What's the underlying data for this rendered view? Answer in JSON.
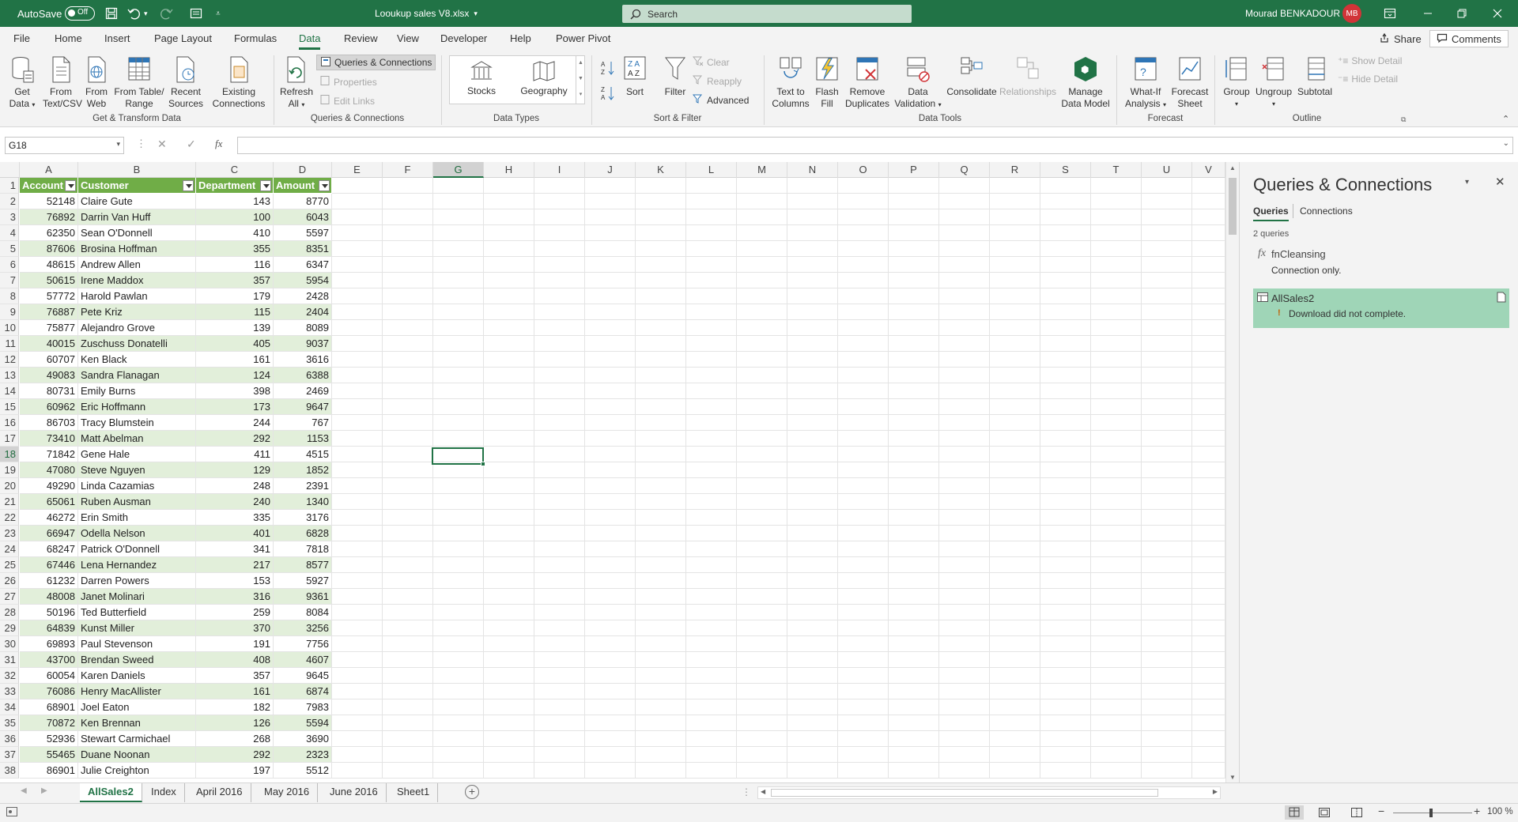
{
  "titlebar": {
    "autosave_label": "AutoSave",
    "autosave_state": "Off",
    "filename": "Looukup sales V8.xlsx",
    "search_placeholder": "Search",
    "user_name": "Mourad BENKADOUR",
    "user_initials": "MB"
  },
  "menu": {
    "tabs": [
      "File",
      "Home",
      "Insert",
      "Page Layout",
      "Formulas",
      "Data",
      "Review",
      "View",
      "Developer",
      "Help",
      "Power Pivot"
    ],
    "active": "Data",
    "share": "Share",
    "comments": "Comments"
  },
  "ribbon": {
    "get_data": [
      "Get",
      "Data"
    ],
    "from_text": [
      "From",
      "Text/CSV"
    ],
    "from_web": [
      "From",
      "Web"
    ],
    "from_table": [
      "From Table/",
      "Range"
    ],
    "recent_sources": [
      "Recent",
      "Sources"
    ],
    "existing_connections": [
      "Existing",
      "Connections"
    ],
    "group_get_transform": "Get & Transform Data",
    "refresh_all": [
      "Refresh",
      "All"
    ],
    "queries_connections": "Queries & Connections",
    "properties": "Properties",
    "edit_links": "Edit Links",
    "group_queries": "Queries & Connections",
    "stocks": "Stocks",
    "geography": "Geography",
    "group_data_types": "Data Types",
    "sort": "Sort",
    "filter": "Filter",
    "clear": "Clear",
    "reapply": "Reapply",
    "advanced": "Advanced",
    "group_sort_filter": "Sort & Filter",
    "text_to_columns": [
      "Text to",
      "Columns"
    ],
    "flash_fill": [
      "Flash",
      "Fill"
    ],
    "remove_duplicates": [
      "Remove",
      "Duplicates"
    ],
    "data_validation": [
      "Data",
      "Validation"
    ],
    "consolidate": "Consolidate",
    "relationships": "Relationships",
    "manage_data_model": [
      "Manage",
      "Data Model"
    ],
    "group_data_tools": "Data Tools",
    "what_if": [
      "What-If",
      "Analysis"
    ],
    "forecast_sheet": [
      "Forecast",
      "Sheet"
    ],
    "group_forecast": "Forecast",
    "group_btn": "Group",
    "ungroup": "Ungroup",
    "subtotal": "Subtotal",
    "show_detail": "Show Detail",
    "hide_detail": "Hide Detail",
    "group_outline": "Outline"
  },
  "formula_bar": {
    "name_box": "G18",
    "formula": ""
  },
  "columns": [
    "A",
    "B",
    "C",
    "D",
    "E",
    "F",
    "G",
    "H",
    "I",
    "J",
    "K",
    "L",
    "M",
    "N",
    "O",
    "P",
    "Q",
    "R",
    "S",
    "T",
    "U",
    "V"
  ],
  "selected_cell": "G18",
  "table": {
    "headers": [
      "Account",
      "Customer",
      "Department",
      "Amount"
    ],
    "rows": [
      [
        "52148",
        "Claire Gute",
        "143",
        "8770"
      ],
      [
        "76892",
        "Darrin Van Huff",
        "100",
        "6043"
      ],
      [
        "62350",
        "Sean O'Donnell",
        "410",
        "5597"
      ],
      [
        "87606",
        "Brosina Hoffman",
        "355",
        "8351"
      ],
      [
        "48615",
        "Andrew Allen",
        "116",
        "6347"
      ],
      [
        "50615",
        "Irene Maddox",
        "357",
        "5954"
      ],
      [
        "57772",
        "Harold Pawlan",
        "179",
        "2428"
      ],
      [
        "76887",
        "Pete Kriz",
        "115",
        "2404"
      ],
      [
        "75877",
        "Alejandro Grove",
        "139",
        "8089"
      ],
      [
        "40015",
        "Zuschuss Donatelli",
        "405",
        "9037"
      ],
      [
        "60707",
        "Ken Black",
        "161",
        "3616"
      ],
      [
        "49083",
        "Sandra Flanagan",
        "124",
        "6388"
      ],
      [
        "80731",
        "Emily Burns",
        "398",
        "2469"
      ],
      [
        "60962",
        "Eric Hoffmann",
        "173",
        "9647"
      ],
      [
        "86703",
        "Tracy Blumstein",
        "244",
        "767"
      ],
      [
        "73410",
        "Matt Abelman",
        "292",
        "1153"
      ],
      [
        "71842",
        "Gene Hale",
        "411",
        "4515"
      ],
      [
        "47080",
        "Steve Nguyen",
        "129",
        "1852"
      ],
      [
        "49290",
        "Linda Cazamias",
        "248",
        "2391"
      ],
      [
        "65061",
        "Ruben Ausman",
        "240",
        "1340"
      ],
      [
        "46272",
        "Erin Smith",
        "335",
        "3176"
      ],
      [
        "66947",
        "Odella Nelson",
        "401",
        "6828"
      ],
      [
        "68247",
        "Patrick O'Donnell",
        "341",
        "7818"
      ],
      [
        "67446",
        "Lena Hernandez",
        "217",
        "8577"
      ],
      [
        "61232",
        "Darren Powers",
        "153",
        "5927"
      ],
      [
        "48008",
        "Janet Molinari",
        "316",
        "9361"
      ],
      [
        "50196",
        "Ted Butterfield",
        "259",
        "8084"
      ],
      [
        "64839",
        "Kunst Miller",
        "370",
        "3256"
      ],
      [
        "69893",
        "Paul Stevenson",
        "191",
        "7756"
      ],
      [
        "43700",
        "Brendan Sweed",
        "408",
        "4607"
      ],
      [
        "60054",
        "Karen Daniels",
        "357",
        "9645"
      ],
      [
        "76086",
        "Henry MacAllister",
        "161",
        "6874"
      ],
      [
        "68901",
        "Joel Eaton",
        "182",
        "7983"
      ],
      [
        "70872",
        "Ken Brennan",
        "126",
        "5594"
      ],
      [
        "52936",
        "Stewart Carmichael",
        "268",
        "3690"
      ],
      [
        "55465",
        "Duane Noonan",
        "292",
        "2323"
      ],
      [
        "86901",
        "Julie Creighton",
        "197",
        "5512"
      ]
    ]
  },
  "queries_panel": {
    "title": "Queries & Connections",
    "tabs": [
      "Queries",
      "Connections"
    ],
    "count": "2 queries",
    "items": [
      {
        "name": "fnCleansing",
        "status": "Connection only."
      },
      {
        "name": "AllSales2",
        "status": "Download did not complete."
      }
    ]
  },
  "sheets": [
    "AllSales2",
    "Index",
    "April 2016",
    "May 2016",
    "June 2016",
    "Sheet1"
  ],
  "active_sheet": "AllSales2",
  "status": {
    "zoom": "100 %"
  }
}
